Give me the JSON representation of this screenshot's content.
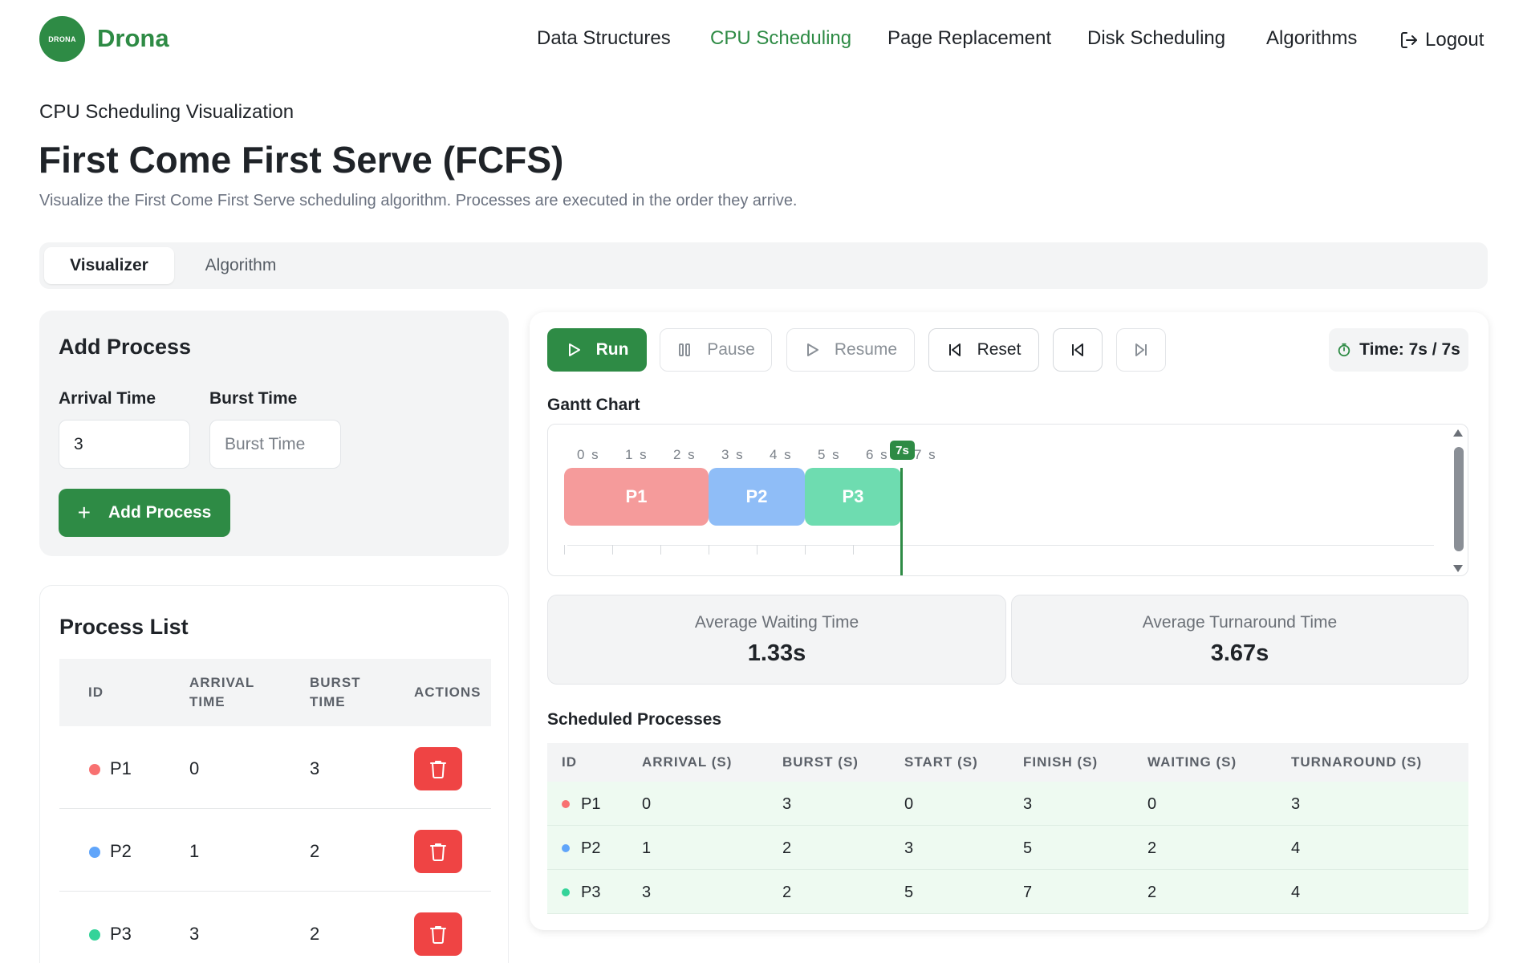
{
  "brand": {
    "logo_text": "DRONA",
    "name": "Drona",
    "color": "#2e8b45"
  },
  "nav": {
    "items": [
      "Data Structures",
      "CPU Scheduling",
      "Page Replacement",
      "Disk Scheduling",
      "Algorithms"
    ],
    "active": "CPU Scheduling",
    "logout": "Logout"
  },
  "page": {
    "eyebrow": "CPU Scheduling Visualization",
    "title": "First Come First Serve (FCFS)",
    "subtitle": "Visualize the First Come First Serve scheduling algorithm. Processes are executed in the order they arrive."
  },
  "tabs": {
    "visualizer": "Visualizer",
    "algorithm": "Algorithm",
    "active": "Visualizer"
  },
  "add_process": {
    "title": "Add Process",
    "arrival_label": "Arrival Time",
    "arrival_value": "3",
    "arrival_placeholder": "Arrival Time",
    "burst_label": "Burst Time",
    "burst_value": "",
    "burst_placeholder": "Burst Time",
    "button": "Add Process"
  },
  "process_list": {
    "title": "Process List",
    "headers": {
      "id": "ID",
      "arrival_1": "ARRIVAL",
      "arrival_2": "TIME",
      "burst_1": "BURST",
      "burst_2": "TIME",
      "actions": "ACTIONS"
    },
    "rows": [
      {
        "id": "P1",
        "arrival": "0",
        "burst": "3",
        "color": "#f87171",
        "action_icon": "trash-icon"
      },
      {
        "id": "P2",
        "arrival": "1",
        "burst": "2",
        "color": "#60a5fa",
        "action_icon": "trash-icon"
      },
      {
        "id": "P3",
        "arrival": "3",
        "burst": "2",
        "color": "#34d399",
        "action_icon": "trash-icon"
      }
    ]
  },
  "controls": {
    "run": "Run",
    "pause": "Pause",
    "resume": "Resume",
    "reset": "Reset",
    "step_back_icon": "skip-back-icon",
    "step_forward_icon": "skip-forward-icon",
    "time_label": "Time: 7s / 7s",
    "time_icon": "timer-icon"
  },
  "gantt": {
    "title": "Gantt Chart",
    "ticks": [
      "0 s",
      "1 s",
      "2 s",
      "3 s",
      "4 s",
      "5 s",
      "6 s",
      "7 s"
    ],
    "current_time": 7,
    "current_label": "7s",
    "bars": [
      {
        "label": "P1",
        "start": 0,
        "end": 3,
        "color": "#f59b9b"
      },
      {
        "label": "P2",
        "start": 3,
        "end": 5,
        "color": "#8fbdf7"
      },
      {
        "label": "P3",
        "start": 5,
        "end": 7,
        "color": "#6edcb0"
      }
    ]
  },
  "stats": {
    "avg_waiting_label": "Average Waiting Time",
    "avg_waiting_value": "1.33s",
    "avg_turnaround_label": "Average Turnaround Time",
    "avg_turnaround_value": "3.67s"
  },
  "scheduled": {
    "title": "Scheduled Processes",
    "headers": [
      "ID",
      "ARRIVAL (S)",
      "BURST (S)",
      "START (S)",
      "FINISH (S)",
      "WAITING (S)",
      "TURNAROUND (S)"
    ],
    "rows": [
      {
        "cells": [
          "P1",
          "0",
          "3",
          "0",
          "3",
          "0",
          "3"
        ],
        "color": "#f87171"
      },
      {
        "cells": [
          "P2",
          "1",
          "2",
          "3",
          "5",
          "2",
          "4"
        ],
        "color": "#60a5fa"
      },
      {
        "cells": [
          "P3",
          "3",
          "2",
          "5",
          "7",
          "2",
          "4"
        ],
        "color": "#34d399"
      }
    ]
  }
}
